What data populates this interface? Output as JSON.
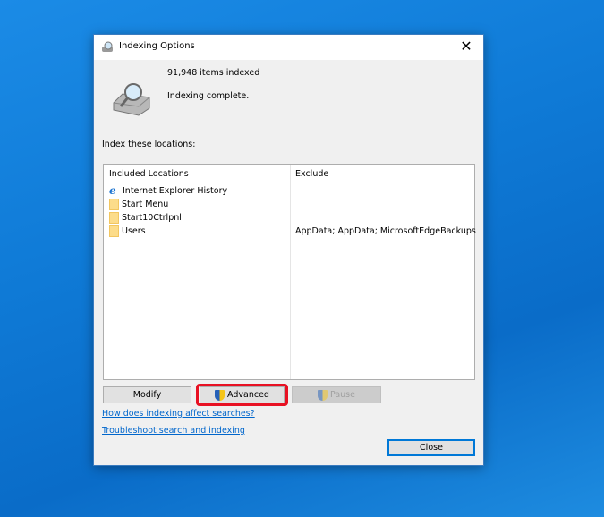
{
  "window": {
    "title": "Indexing Options",
    "close_glyph": "✕"
  },
  "status": {
    "items_indexed": "91,948 items indexed",
    "state": "Indexing complete."
  },
  "locations_label": "Index these locations:",
  "table": {
    "headers": [
      "Included Locations",
      "Exclude"
    ],
    "rows": [
      {
        "location": "Internet Explorer History",
        "exclude": "",
        "icon": "ie-icon"
      },
      {
        "location": "Start Menu",
        "exclude": "",
        "icon": "folder-icon"
      },
      {
        "location": "Start10Ctrlpnl",
        "exclude": "",
        "icon": "folder-icon"
      },
      {
        "location": "Users",
        "exclude": "AppData; AppData; MicrosoftEdgeBackups",
        "icon": "folder-icon"
      }
    ]
  },
  "buttons": {
    "modify": "Modify",
    "advanced": "Advanced",
    "pause": "Pause",
    "close": "Close"
  },
  "links": {
    "how": "How does indexing affect searches?",
    "troubleshoot": "Troubleshoot search and indexing"
  },
  "colors": {
    "highlight": "#e81123",
    "link": "#0066cc",
    "desktop": "#0f7ad6"
  }
}
